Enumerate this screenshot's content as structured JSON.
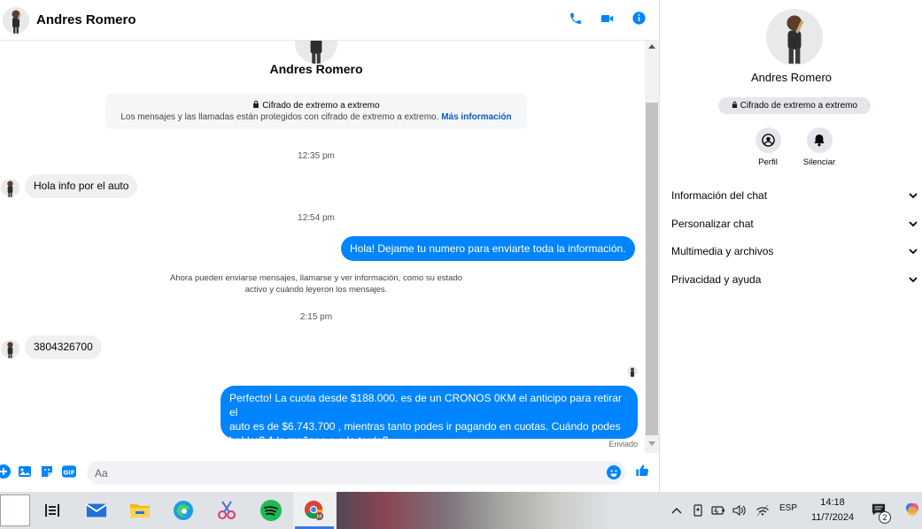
{
  "contact": {
    "name": "Andres Romero"
  },
  "header": {
    "actions": [
      {
        "icon": "phone-icon"
      },
      {
        "icon": "video-call-icon"
      },
      {
        "icon": "info-icon"
      }
    ]
  },
  "encryption": {
    "title": "Cifrado de extremo a extremo",
    "description": "Los mensajes y las llamadas están protegidos con cifrado de extremo a extremo.",
    "link": "Más información"
  },
  "messages": {
    "ts1": "12:35 pm",
    "m1": "Hola info por el auto",
    "ts2": "12:54 pm",
    "m2": "Hola! Dejame tu numero  para enviarte toda la información.",
    "notice_line1": "Ahora pueden enviarse mensajes, llamarse y ver información, como su estado",
    "notice_line2": "activo y cuándo leyeron los mensajes.",
    "ts3": "2:15 pm",
    "m3": "3804326700",
    "m4_line1": "Perfecto! La cuota desde $188.000. es de un CRONOS 0KM el anticipo para retirar el",
    "m4_line2": "auto es de $6.743.700 , mientras tanto podes ir pagando en cuotas. Cuándo podes",
    "m4_line3": "hablar? A la mañana o a la tarde?",
    "status": "Enviado"
  },
  "composer": {
    "placeholder": "Aa",
    "icons": [
      "plus-icon",
      "image-icon",
      "sticker-icon",
      "gif-icon",
      "emoji-icon",
      "like-icon"
    ]
  },
  "panel": {
    "encryption_pill": "Cifrado de extremo a extremo",
    "actions": {
      "profile": "Perfil",
      "mute": "Silenciar"
    },
    "sections": [
      "Información del chat",
      "Personalizar chat",
      "Multimedia y archivos",
      "Privacidad y ayuda"
    ]
  },
  "taskbar": {
    "language": "ESP",
    "time": "14:18",
    "date": "11/7/2024",
    "notifications": "2"
  },
  "colors": {
    "accent": "#0084ff",
    "link": "#0a5bc7"
  }
}
